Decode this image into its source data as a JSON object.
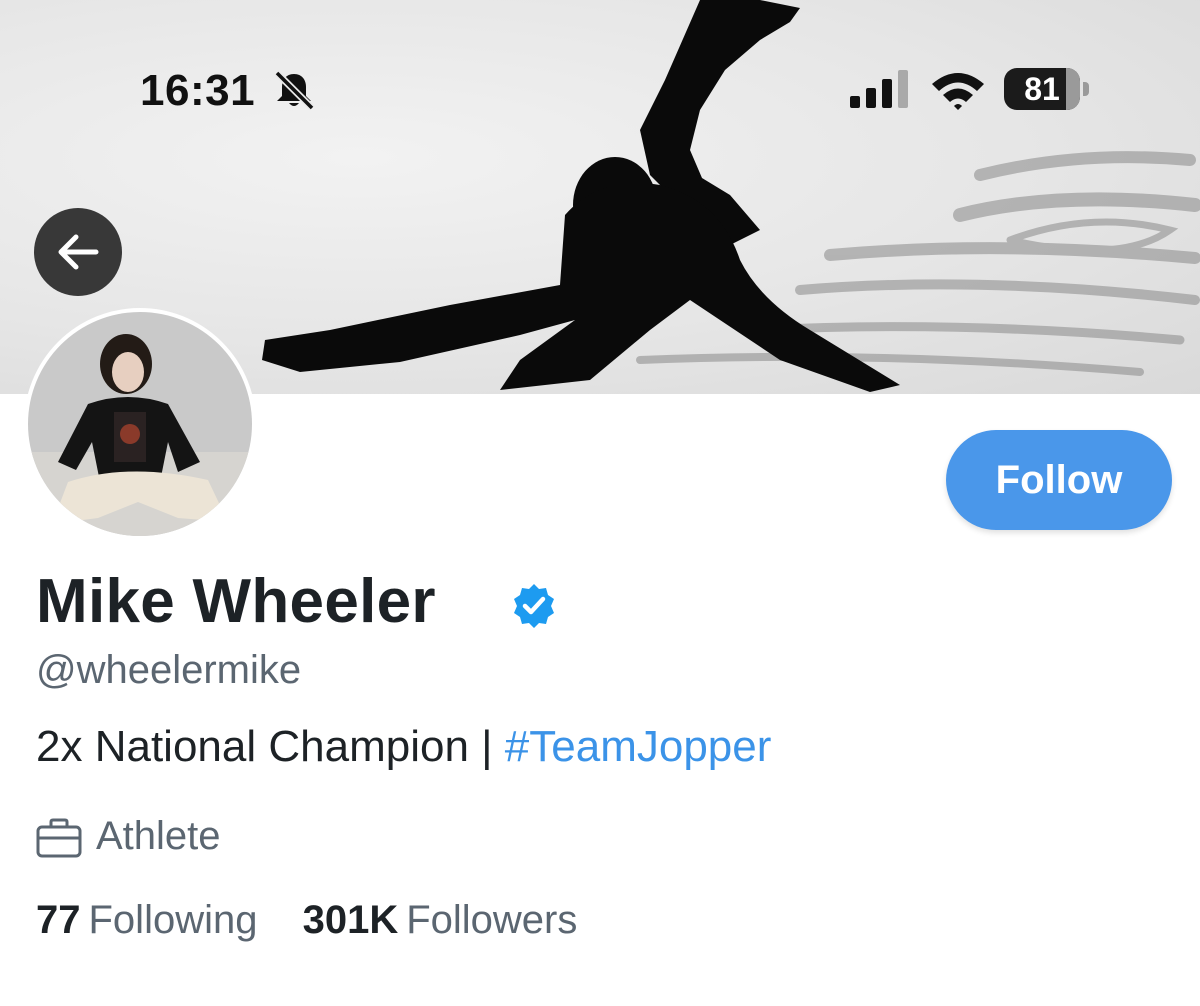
{
  "status_bar": {
    "time": "16:31",
    "battery_level": "81",
    "battery_fraction": 0.81
  },
  "icons": {
    "back": "arrow-left",
    "mute": "bell-slash",
    "signal": "cellular-bars",
    "wifi": "wifi",
    "verified": "verified-check",
    "profession": "briefcase"
  },
  "colors": {
    "accent": "#4a97ea",
    "hashtag": "#3b93e8",
    "verified": "#1d9bf0",
    "secondary_text": "#5b6671"
  },
  "profile": {
    "display_name": "Mike Wheeler",
    "handle": "@wheelermike",
    "bio_text": "2x National Champion | ",
    "bio_hashtag": "#TeamJopper",
    "profession": "Athlete",
    "follow_label": "Follow",
    "following_count": "77",
    "following_label": "Following",
    "followers_count": "301K",
    "followers_label": "Followers"
  }
}
